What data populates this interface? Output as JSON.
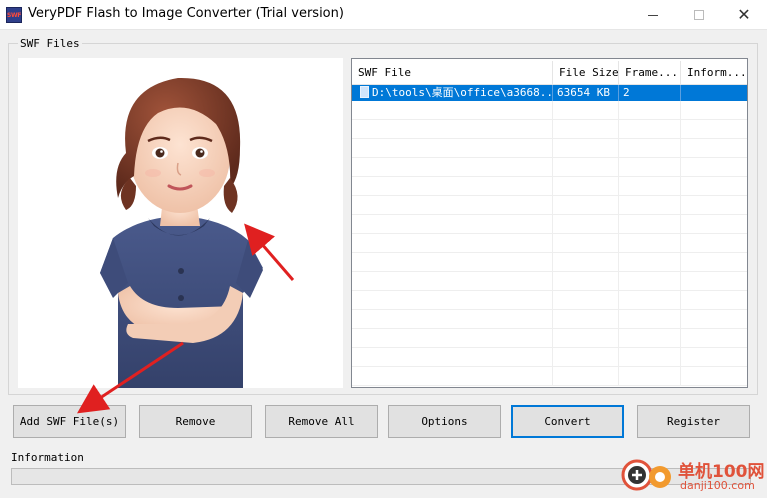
{
  "window": {
    "title": "VeryPDF Flash to Image Converter (Trial version)",
    "app_icon_text": "SWF",
    "controls": {
      "minimize": "minimize-icon",
      "maximize": "maximize-icon",
      "close": "close-icon"
    }
  },
  "swf_group": {
    "label": "SWF Files",
    "preview_image": "woman-portrait-illustration",
    "table": {
      "columns": [
        "SWF File",
        "File Size",
        "Frame...",
        "Inform..."
      ],
      "rows": [
        {
          "file": "D:\\tools\\桌面\\office\\a3668...",
          "size": "63654 KB",
          "frames": "2",
          "info": "",
          "selected": true
        }
      ]
    }
  },
  "buttons": {
    "add": "Add SWF File(s)",
    "remove": "Remove",
    "remove_all": "Remove All",
    "options": "Options",
    "convert": "Convert",
    "register": "Register"
  },
  "information": {
    "label": "Information",
    "progress": 0
  },
  "watermark": {
    "line1": "单机100网",
    "line2": "danji100.com"
  },
  "colors": {
    "selection": "#0078d7",
    "annotation_arrow": "#e02020",
    "watermark": "#e0523a"
  }
}
